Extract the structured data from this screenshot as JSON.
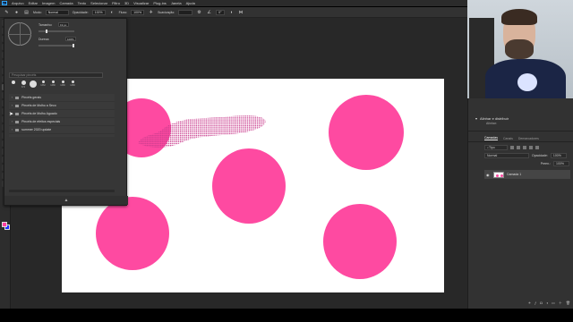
{
  "menubar": {
    "logo": "Ps",
    "items": [
      "Arquivo",
      "Editar",
      "Imagem",
      "Camada",
      "Texto",
      "Selecionar",
      "Filtro",
      "3D",
      "Visualizar",
      "Plug-ins",
      "Janela",
      "Ajuda"
    ]
  },
  "options": {
    "mode_label": "Modo:",
    "mode_value": "Normal",
    "opacity_label": "Opacidade:",
    "opacity_value": "100%",
    "flow_label": "Fluxo:",
    "flow_value": "100%",
    "smoothing_label": "Suavização:",
    "angle_value": "0°"
  },
  "brush_panel": {
    "size_label": "Tamanho:",
    "size_value": "19 px",
    "hardness_label": "Dureza:",
    "hardness_value": "100%",
    "search_placeholder": "Pesquisar pincéis",
    "tips": [
      {
        "num": "",
        "size": 4
      },
      {
        "num": "374",
        "size": 5
      },
      {
        "num": "",
        "size": 8
      },
      {
        "num": "1362",
        "size": 3
      },
      {
        "num": "1480",
        "size": 3
      },
      {
        "num": "1480",
        "size": 3
      },
      {
        "num": "1480",
        "size": 3
      }
    ],
    "folders": [
      "Pincéis gerais",
      "Pincéis de Molho a Seco",
      "Pincéis de Molho Aguado",
      "Pincéis de efeitos especiais",
      "summer 2020 update"
    ]
  },
  "right_panel": {
    "align_title": "Alinhar e distribuir",
    "align_sub": "Alinhar:",
    "tabs": [
      "Camadas",
      "Canais",
      "Demarcadores"
    ],
    "filter_value": "Tipo",
    "blend_mode": "Normal",
    "opacity_label": "Opacidade:",
    "opacity_value": "100%",
    "fill_label": "Preen.:",
    "fill_value": "100%",
    "layer_name": "Camada 1"
  },
  "colors": {
    "foreground": "#ff3fa0",
    "background": "#1a2cff",
    "circle": "#fe4aa1"
  },
  "icons": [
    "brush-icon",
    "search-icon",
    "folder-icon",
    "eye-icon",
    "cursor-icon",
    "gear-icon"
  ]
}
